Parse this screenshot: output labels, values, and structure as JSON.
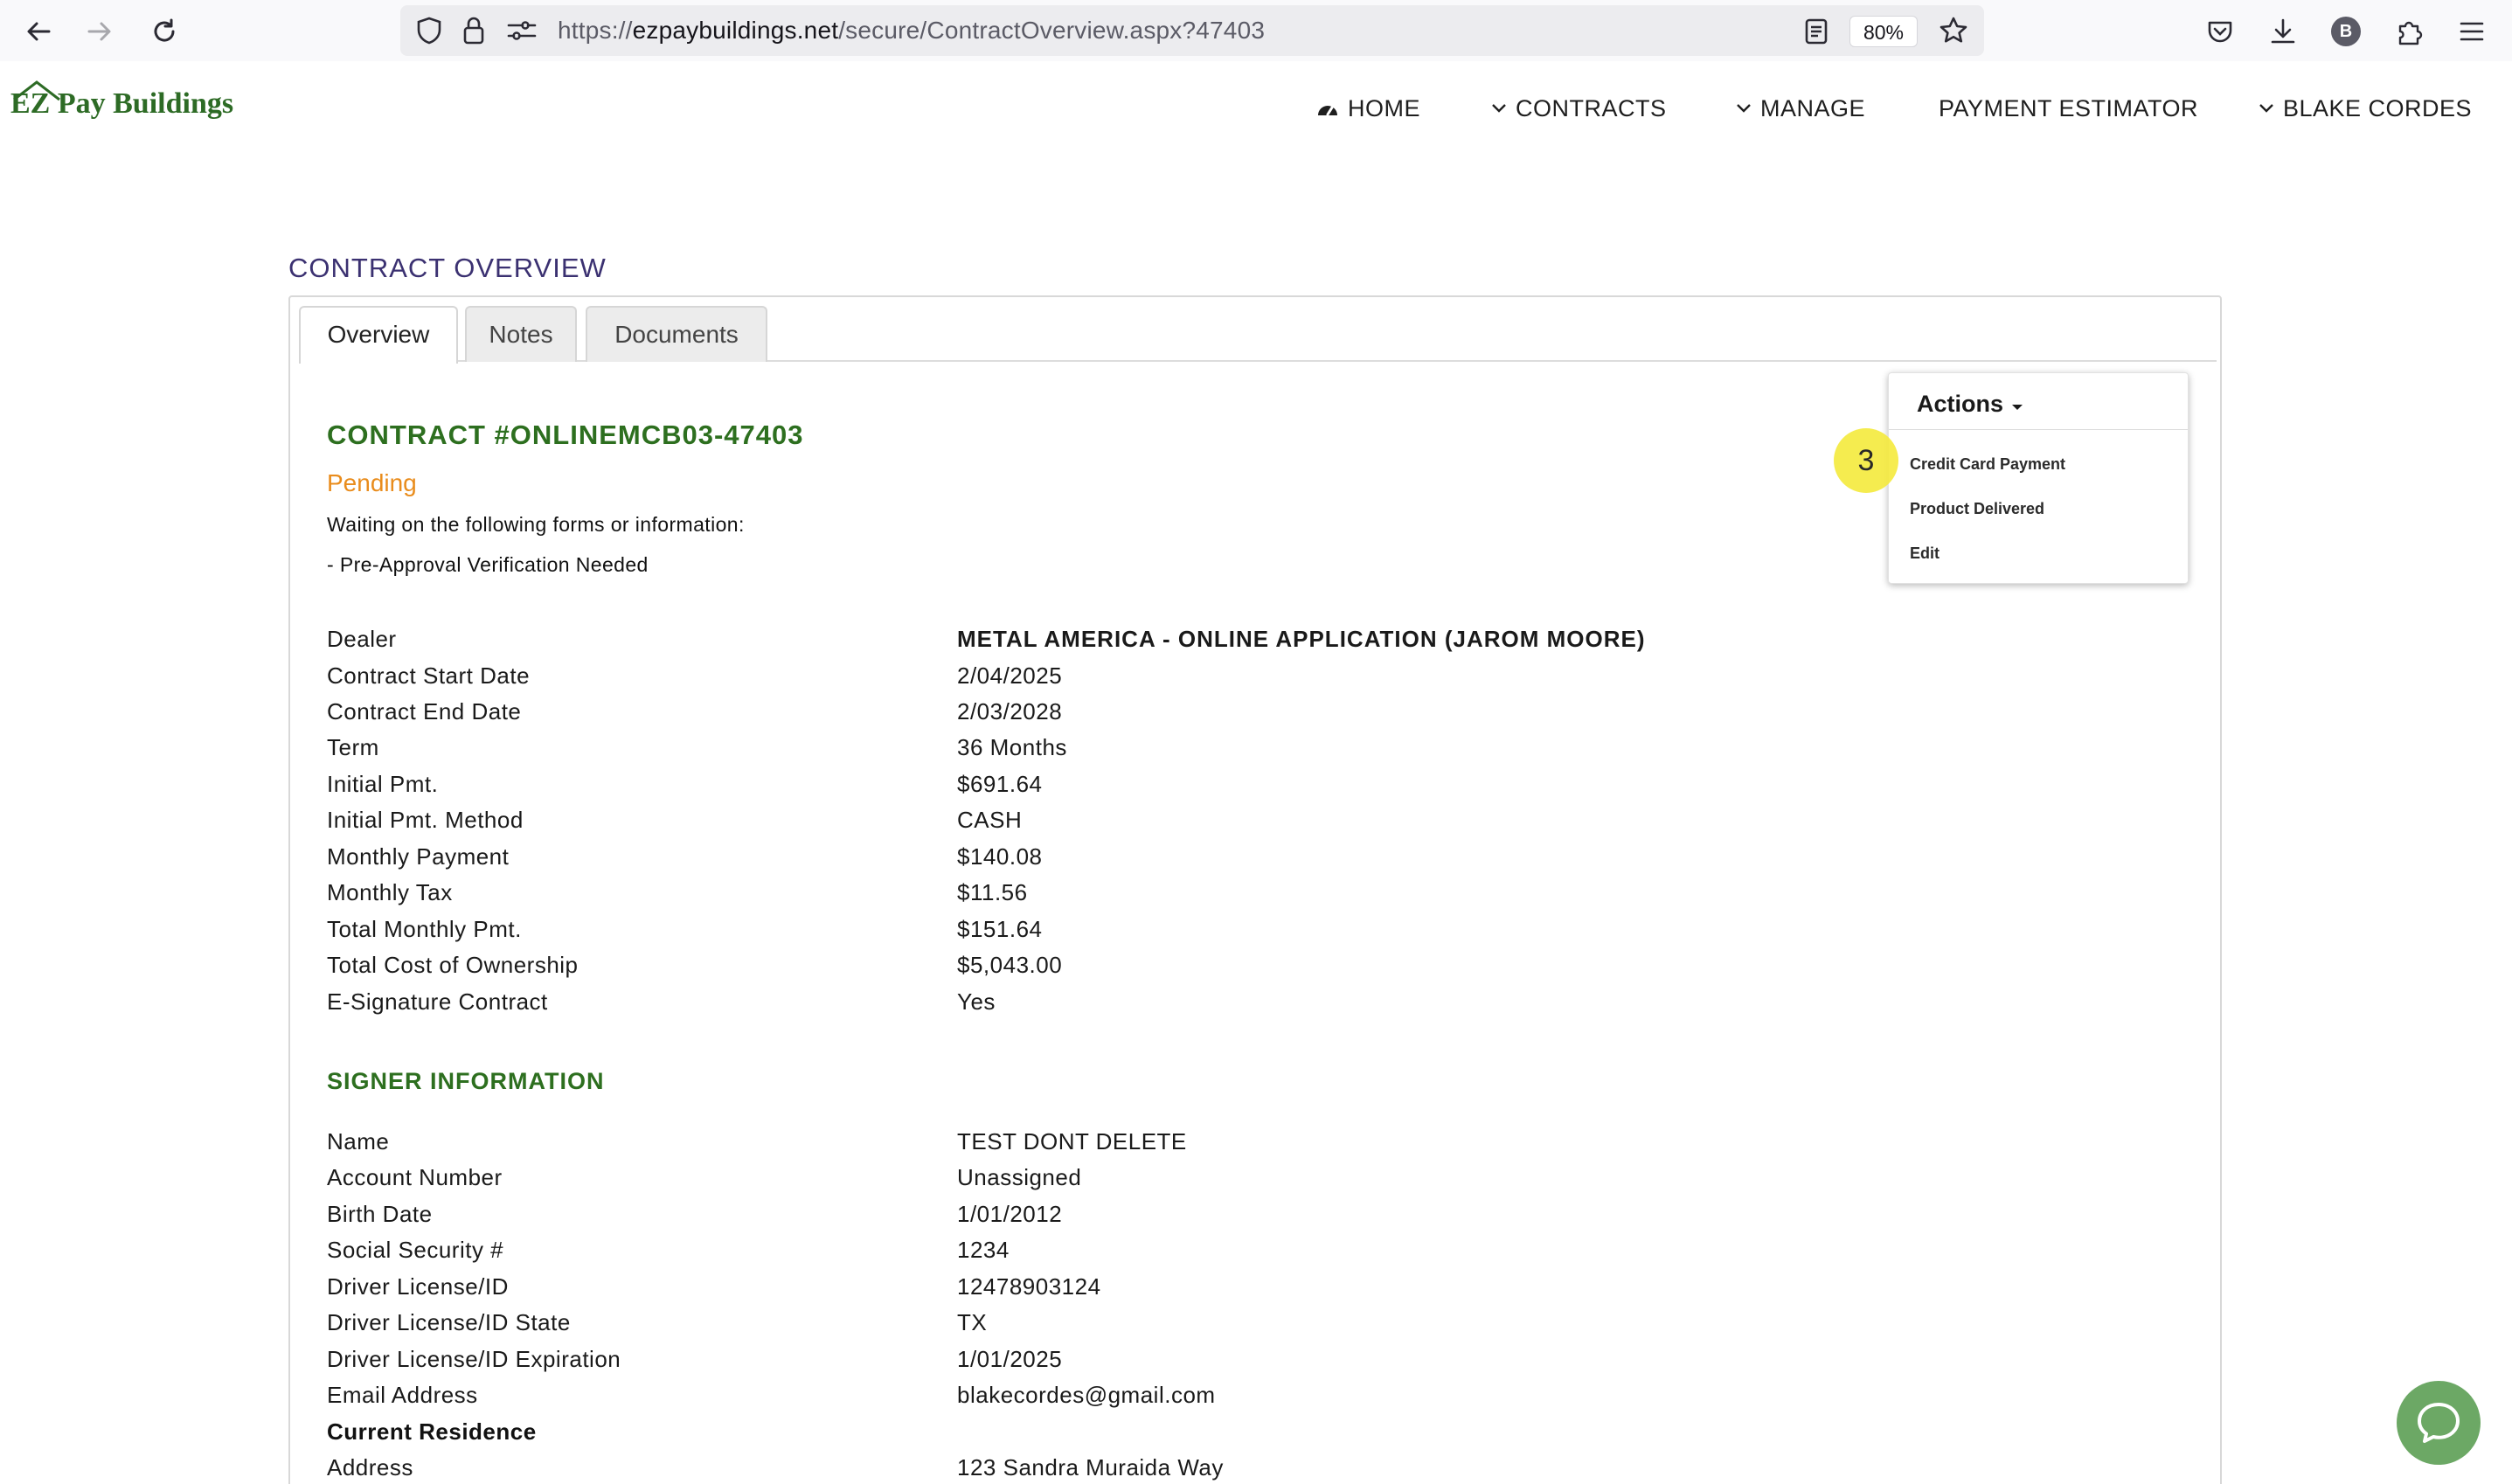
{
  "browser": {
    "url_prefix": "https://",
    "url_domain": "ezpaybuildings.net",
    "url_path": "/secure/ContractOverview.aspx?47403",
    "zoom": "80%",
    "profile_initial": "B"
  },
  "site": {
    "logo_text": "EZ Pay Buildings",
    "nav": {
      "home": "HOME",
      "contracts": "CONTRACTS",
      "manage": "MANAGE",
      "payment_estimator": "PAYMENT ESTIMATOR",
      "user": "BLAKE CORDES"
    }
  },
  "page": {
    "title": "CONTRACT OVERVIEW",
    "tabs": [
      "Overview",
      "Notes",
      "Documents"
    ],
    "active_tab": "Overview"
  },
  "contract": {
    "heading": "CONTRACT #ONLINEMCB03-47403",
    "status": "Pending",
    "waiting_text": "Waiting on the following forms or information:",
    "requirement": "- Pre-Approval Verification Needed",
    "details": [
      {
        "label": "Dealer",
        "value": "METAL AMERICA - ONLINE APPLICATION (JAROM MOORE)"
      },
      {
        "label": "Contract Start Date",
        "value": "2/04/2025"
      },
      {
        "label": "Contract End Date",
        "value": "2/03/2028"
      },
      {
        "label": "Term",
        "value": "36 Months"
      },
      {
        "label": "Initial Pmt.",
        "value": "$691.64"
      },
      {
        "label": "Initial Pmt. Method",
        "value": "CASH"
      },
      {
        "label": "Monthly Payment",
        "value": "$140.08"
      },
      {
        "label": "Monthly Tax",
        "value": "$11.56"
      },
      {
        "label": "Total Monthly Pmt.",
        "value": "$151.64"
      },
      {
        "label": "Total Cost of Ownership",
        "value": "$5,043.00"
      },
      {
        "label": "E-Signature Contract",
        "value": "Yes"
      }
    ]
  },
  "signer": {
    "heading": "SIGNER INFORMATION",
    "details": [
      {
        "label": "Name",
        "value": "TEST DONT DELETE"
      },
      {
        "label": "Account Number",
        "value": "Unassigned"
      },
      {
        "label": "Birth Date",
        "value": "1/01/2012"
      },
      {
        "label": "Social Security #",
        "value": "1234"
      },
      {
        "label": "Driver License/ID",
        "value": "12478903124"
      },
      {
        "label": "Driver License/ID State",
        "value": "TX"
      },
      {
        "label": "Driver License/ID Expiration",
        "value": "1/01/2025"
      },
      {
        "label": "Email Address",
        "value": "blakecordes@gmail.com"
      }
    ],
    "residence_heading": "Current Residence",
    "address_label": "Address",
    "address_value": "123 Sandra Muraida Way"
  },
  "actions_menu": {
    "label": "Actions",
    "items": [
      "Credit Card Payment",
      "Product Delivered",
      "Edit"
    ],
    "step_marker": "3"
  },
  "colors": {
    "brand_green": "#2d6f1f",
    "status_orange": "#e98c1c",
    "title_purple": "#3b3171",
    "chat_green": "#6ca865",
    "highlight_yellow": "#f5ea3c"
  }
}
